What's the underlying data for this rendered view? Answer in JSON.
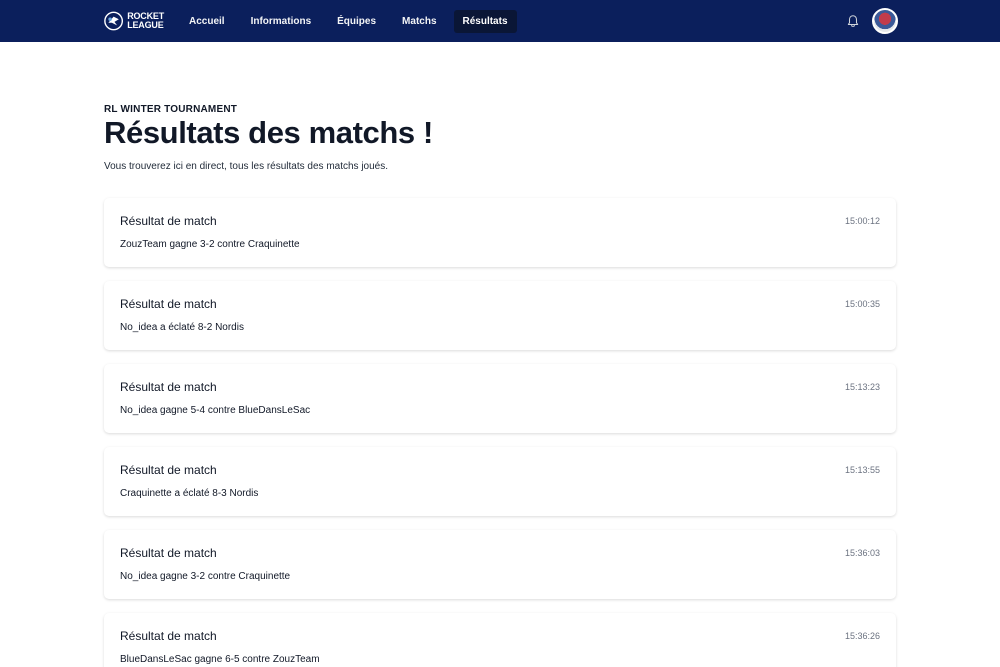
{
  "navbar": {
    "logo_text": [
      "ROCKET",
      "LEAGUE"
    ],
    "links": [
      {
        "label": "Accueil",
        "active": false
      },
      {
        "label": "Informations",
        "active": false
      },
      {
        "label": "Équipes",
        "active": false
      },
      {
        "label": "Matchs",
        "active": false
      },
      {
        "label": "Résultats",
        "active": true
      }
    ],
    "icons": {
      "notification": "bell-icon",
      "profile": "avatar"
    },
    "colors": {
      "background": "#0b1f5c",
      "active_link_bg": "#0a1636"
    }
  },
  "header": {
    "eyebrow": "RL WINTER TOURNAMENT",
    "title": "Résultats des matchs !",
    "subtitle": "Vous trouverez ici en direct, tous les résultats des matchs joués."
  },
  "results": [
    {
      "title": "Résultat de match",
      "time": "15:00:12",
      "text": "ZouzTeam gagne 3-2 contre Craquinette"
    },
    {
      "title": "Résultat de match",
      "time": "15:00:35",
      "text": "No_idea a éclaté 8-2 Nordis"
    },
    {
      "title": "Résultat de match",
      "time": "15:13:23",
      "text": "No_idea gagne 5-4 contre BlueDansLeSac"
    },
    {
      "title": "Résultat de match",
      "time": "15:13:55",
      "text": "Craquinette a éclaté 8-3 Nordis"
    },
    {
      "title": "Résultat de match",
      "time": "15:36:03",
      "text": "No_idea gagne 3-2 contre Craquinette"
    },
    {
      "title": "Résultat de match",
      "time": "15:36:26",
      "text": "BlueDansLeSac gagne 6-5 contre ZouzTeam"
    }
  ]
}
